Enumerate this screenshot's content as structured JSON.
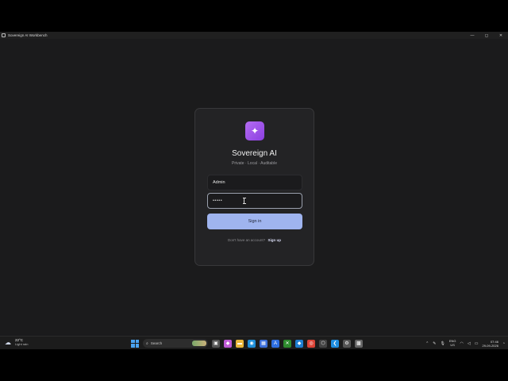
{
  "window": {
    "title": "Sovereign AI Workbench",
    "controls": {
      "minimize": "—",
      "maximize": "◻",
      "close": "✕"
    }
  },
  "login": {
    "logo_glyph": "✦",
    "app_name": "Sovereign AI",
    "tagline": "Private · Local · Auditable",
    "username_value": "Admin",
    "password_value": "•••••",
    "signin_label": "Sign in",
    "signup_prompt": "Don't have an account?",
    "signup_link": "Sign up",
    "colors": {
      "accent": "#9fb4ef",
      "logo": "#9b4fe6",
      "card": "#232325",
      "background": "#1b1b1c"
    }
  },
  "taskbar": {
    "weather": {
      "temp": "22°C",
      "desc": "Light rain",
      "icon": "cloud-rain-icon"
    },
    "search_label": "Search",
    "apps": [
      {
        "name": "task-view-icon",
        "glyph": "▣",
        "color": "#555"
      },
      {
        "name": "copilot-icon",
        "glyph": "◆",
        "color": "#c05bd6"
      },
      {
        "name": "file-explorer-icon",
        "glyph": "▬",
        "color": "#e8b63a"
      },
      {
        "name": "edge-icon",
        "glyph": "◉",
        "color": "#1f8fd8"
      },
      {
        "name": "store-icon",
        "glyph": "▦",
        "color": "#3d6fd8"
      },
      {
        "name": "app-icon",
        "glyph": "A",
        "color": "#2f6fe0"
      },
      {
        "name": "xbox-icon",
        "glyph": "✕",
        "color": "#2e8b2e"
      },
      {
        "name": "app-icon",
        "glyph": "◆",
        "color": "#1f7fd0"
      },
      {
        "name": "chrome-icon",
        "glyph": "◎",
        "color": "#db4437"
      },
      {
        "name": "app-icon",
        "glyph": "⬡",
        "color": "#444"
      },
      {
        "name": "vscode-icon",
        "glyph": "❮",
        "color": "#1f8ee0"
      },
      {
        "name": "settings-icon",
        "glyph": "⚙",
        "color": "#555"
      },
      {
        "name": "workbench-icon",
        "glyph": "▩",
        "color": "#666"
      }
    ],
    "tray": {
      "lang_top": "ENG",
      "lang_bottom": "US",
      "time": "07:46",
      "date": "29-09-2026"
    }
  }
}
